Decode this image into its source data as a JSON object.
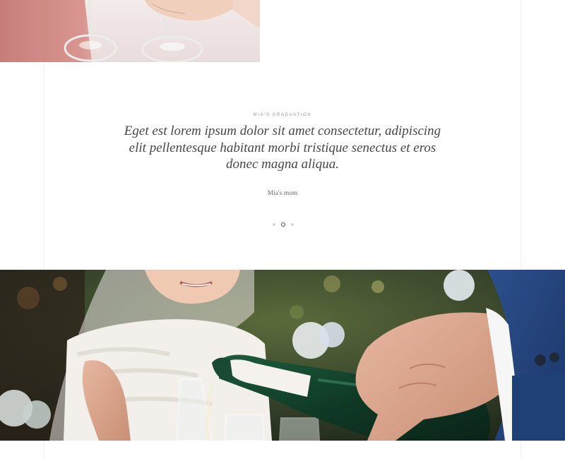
{
  "testimonial": {
    "eyebrow": "Mia's Graduation",
    "quote": "Eget est lorem ipsum dolor sit amet consectetur, adipiscing elit pellentesque habitant morbi tristique senectus et eros donec magna aliqua.",
    "author": "Mia's mom"
  },
  "slider": {
    "dot_count": 3,
    "active_index": 1
  },
  "colors": {
    "accent_text": "#474747",
    "muted_text": "#9a9a9a",
    "dot_inactive": "#d6d6d6",
    "dot_active_border": "#4a4a4a"
  }
}
